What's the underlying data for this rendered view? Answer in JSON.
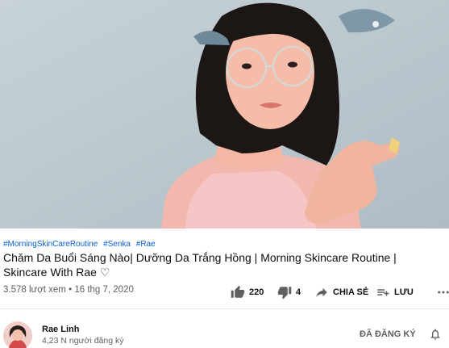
{
  "video": {
    "thumbnail": "woman-in-glasses-pink-top"
  },
  "hashtags": [
    "#MorningSkinCareRoutine",
    "#Senka",
    "#Rae"
  ],
  "title": "Chăm Da Buổi Sáng Nào| Dưỡng Da Trắng Hồng | Morning Skincare Routine | Skincare With Rae ♡",
  "meta": {
    "views": "3.578 lượt xem",
    "separator": "•",
    "date": "16 thg 7, 2020"
  },
  "actions": {
    "like_count": "220",
    "dislike_count": "4",
    "share_label": "CHIA SẺ",
    "save_label": "LƯU",
    "more_icon": "more-horizontal-icon"
  },
  "channel": {
    "name": "Rae Linh",
    "subscribers": "4,23 N người đăng ký",
    "subscribe_label": "ĐÃ ĐĂNG KÝ",
    "bell_icon": "bell-icon"
  },
  "colors": {
    "link": "#065fd4",
    "secondary_text": "#606060"
  }
}
